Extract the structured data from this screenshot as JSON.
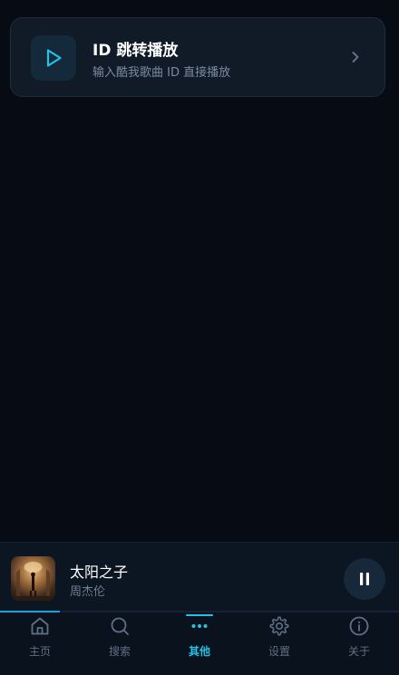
{
  "card": {
    "title": "ID 跳转播放",
    "subtitle": "输入酷我歌曲 ID 直接播放",
    "icon": "play-icon",
    "accent": "#22c3ea"
  },
  "player": {
    "title": "太阳之子",
    "artist": "周杰伦",
    "state_icon": "pause-icon",
    "progress": 0.15,
    "progress_color": "#1aa2e0"
  },
  "nav": {
    "items": [
      {
        "label": "主页",
        "icon": "home-icon",
        "active": false
      },
      {
        "label": "搜索",
        "icon": "search-icon",
        "active": false
      },
      {
        "label": "其他",
        "icon": "more-icon",
        "active": true
      },
      {
        "label": "设置",
        "icon": "gear-icon",
        "active": false
      },
      {
        "label": "关于",
        "icon": "info-icon",
        "active": false
      }
    ],
    "active_color": "#22c3ea",
    "inactive_color": "#5f7085"
  }
}
